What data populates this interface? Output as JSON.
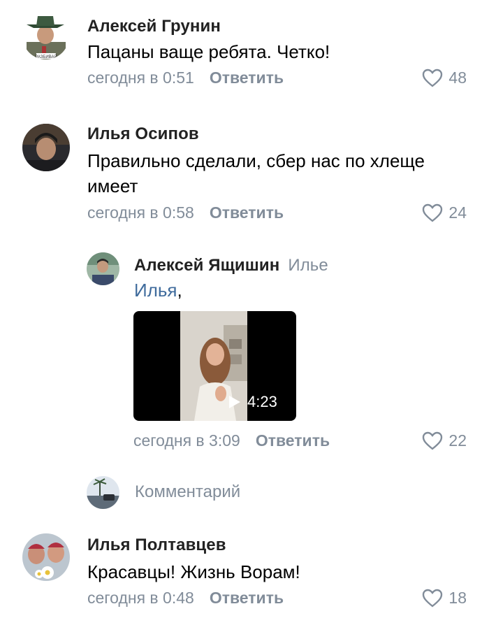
{
  "comments": [
    {
      "author": "Алексей Грунин",
      "text": "Пацаны ваще ребята. Четко!",
      "time": "сегодня в 0:51",
      "reply_label": "Ответить",
      "likes": "48",
      "avatar_label": "РАЗБИВАЙ"
    },
    {
      "author": "Илья Осипов",
      "text": "Правильно сделали, сбер нас по хлеще имеет",
      "time": "сегодня в 0:58",
      "reply_label": "Ответить",
      "likes": "24"
    },
    {
      "author": "Алексей Ящишин",
      "reply_to": "Илье",
      "mention": "Илья",
      "mention_suffix": ",",
      "video_duration": "4:23",
      "time": "сегодня в 3:09",
      "reply_label": "Ответить",
      "likes": "22"
    },
    {
      "author": "Илья Полтавцев",
      "text": "Красавцы! Жизнь Ворам!",
      "time": "сегодня в 0:48",
      "reply_label": "Ответить",
      "likes": "18"
    }
  ],
  "comment_input": {
    "placeholder": "Комментарий"
  },
  "colors": {
    "secondary_text": "#818c99",
    "mention": "#3f6b9c",
    "primary_text": "#000000"
  }
}
